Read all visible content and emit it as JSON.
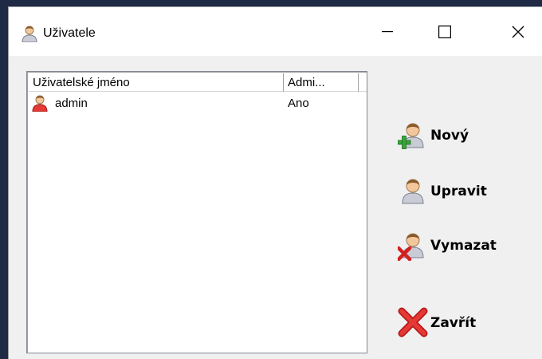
{
  "window": {
    "title": "Uživatele",
    "title_icon": "user-icon"
  },
  "titlebar_buttons": {
    "minimize_icon": "minimize-icon",
    "maximize_icon": "maximize-icon",
    "close_icon": "close-icon"
  },
  "listview": {
    "columns": [
      "Uživatelské jméno",
      "Admi..."
    ],
    "rows": [
      {
        "name": "admin",
        "admin": "Ano",
        "icon": "admin-user-icon"
      }
    ]
  },
  "actions": {
    "new_label": "Nový",
    "edit_label": "Upravit",
    "delete_label": "Vymazat",
    "close_label": "Zavřít"
  },
  "colors": {
    "window_bg": "#f0f0f0",
    "titlebar_bg": "#ffffff",
    "add_green": "#3aa53a",
    "delete_red": "#d42020"
  }
}
